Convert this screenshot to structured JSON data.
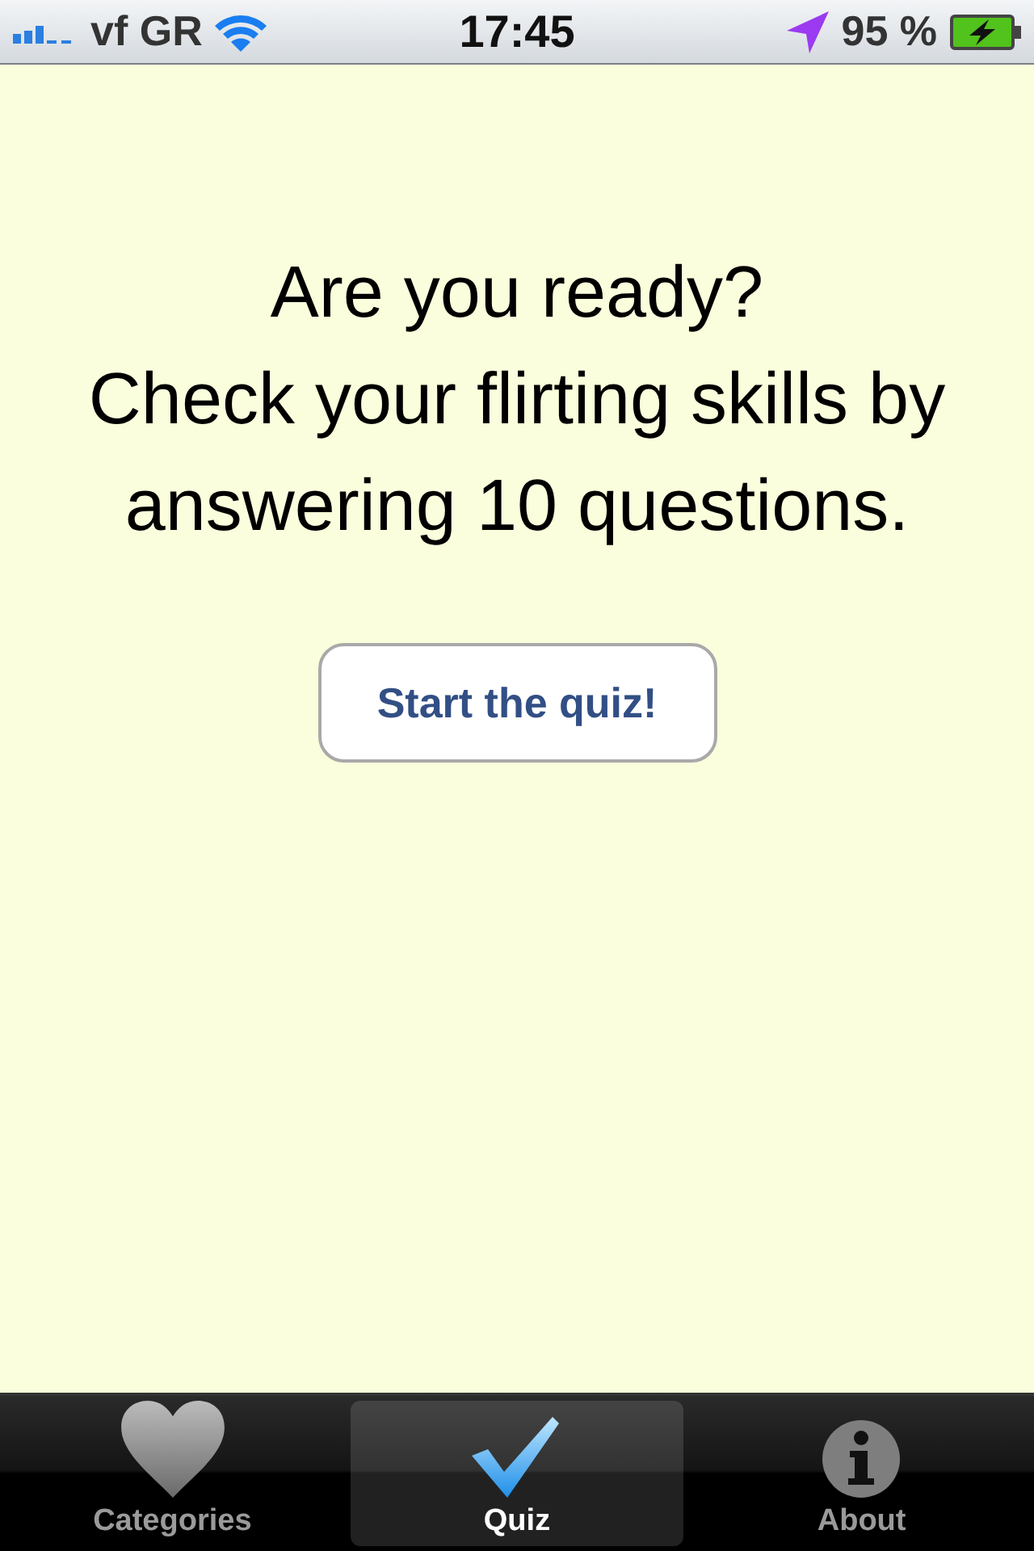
{
  "status_bar": {
    "carrier": "vf GR",
    "time": "17:45",
    "battery": "95 %"
  },
  "prompt": {
    "lines": [
      "Are you ready?",
      "Check your flirting skills by answering 10 questions."
    ]
  },
  "start_button": "Start the quiz!",
  "tabs": [
    {
      "label": "Categories",
      "kind": "heart",
      "selected": false
    },
    {
      "label": "Quiz",
      "kind": "check",
      "selected": true
    },
    {
      "label": "About",
      "kind": "info",
      "selected": false
    }
  ]
}
